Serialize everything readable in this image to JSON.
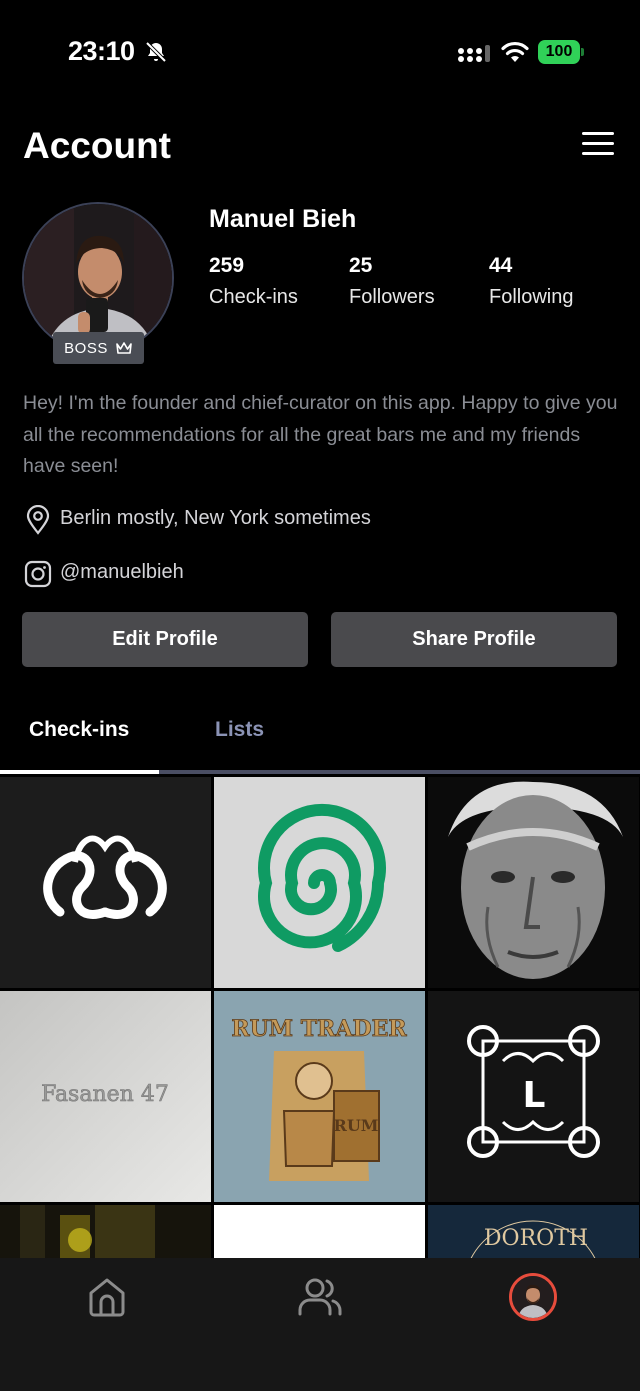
{
  "status_bar": {
    "time": "23:10",
    "battery": "100"
  },
  "header": {
    "title": "Account"
  },
  "profile": {
    "badge": "BOSS",
    "name": "Manuel Bieh",
    "stats": [
      {
        "value": "259",
        "label": "Check-ins"
      },
      {
        "value": "25",
        "label": "Followers"
      },
      {
        "value": "44",
        "label": "Following"
      }
    ],
    "bio": "Hey! I'm the founder and chief-curator on this app. Happy to give you all the recommendations for all the great bars me and my friends have seen!",
    "location": "Berlin mostly, New York sometimes",
    "instagram": "@manuelbieh"
  },
  "actions": {
    "edit": "Edit Profile",
    "share": "Share Profile"
  },
  "tabs": [
    {
      "label": "Check-ins",
      "active": true
    },
    {
      "label": "Lists",
      "active": false
    }
  ],
  "grid": {
    "fasanen": "Fasanen 47",
    "rum_trader": "RUM TRADER",
    "rum": "RUM",
    "monogram": "L",
    "dorothy": "DOROTH"
  },
  "colors": {
    "battery": "#30d158",
    "spiral": "#0f9b63",
    "active_avatar_ring": "#e74c3c"
  }
}
